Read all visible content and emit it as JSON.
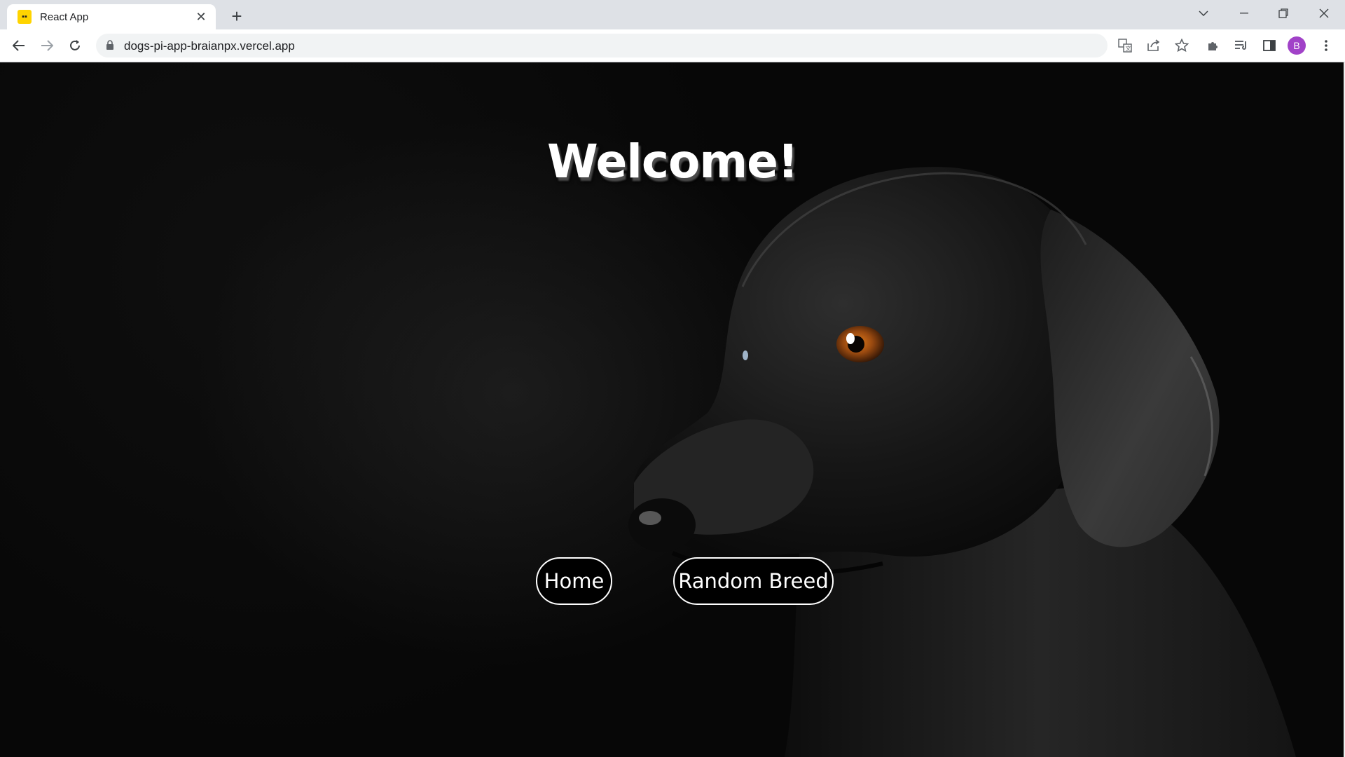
{
  "browser": {
    "tab": {
      "title": "React App",
      "favicon": "react-app-favicon"
    },
    "new_tab_label": "+",
    "url": "dogs-pi-app-braianpx.vercel.app",
    "profile_initial": "B"
  },
  "page": {
    "heading": "Welcome!",
    "buttons": {
      "home": "Home",
      "random_breed": "Random Breed"
    },
    "background": "black-labrador-photo"
  },
  "colors": {
    "accent_profile": "#a142c8",
    "page_background": "#050505",
    "button_border": "#ffffff"
  }
}
